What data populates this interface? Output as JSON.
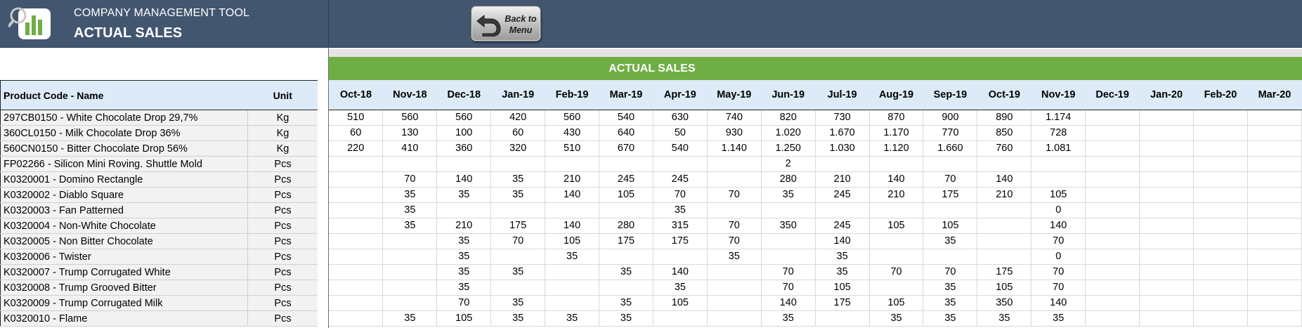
{
  "header": {
    "app_name": "COMPANY MANAGEMENT TOOL",
    "page_title": "ACTUAL SALES",
    "logo_icon": "chart-magnifier-icon",
    "colors": {
      "header_bg": "#435670",
      "band_green": "#6fae44",
      "header_row_blue": "#dcebf7"
    }
  },
  "back_button": {
    "label": "Back to\nMenu",
    "icon": "back-arrow-icon"
  },
  "band": {
    "title": "ACTUAL SALES"
  },
  "columns": {
    "product": "Product Code - Name",
    "unit": "Unit"
  },
  "months": [
    "Oct-18",
    "Nov-18",
    "Dec-18",
    "Jan-19",
    "Feb-19",
    "Mar-19",
    "Apr-19",
    "May-19",
    "Jun-19",
    "Jul-19",
    "Aug-19",
    "Sep-19",
    "Oct-19",
    "Nov-19",
    "Dec-19",
    "Jan-20",
    "Feb-20",
    "Mar-20"
  ],
  "rows": [
    {
      "product": "297CB0150 - White Chocolate Drop 29,7%",
      "unit": "Kg",
      "values": [
        "510",
        "560",
        "560",
        "420",
        "560",
        "540",
        "630",
        "740",
        "820",
        "730",
        "870",
        "900",
        "890",
        "1.174",
        "",
        "",
        "",
        ""
      ]
    },
    {
      "product": "360CL0150 - Milk Chocolate Drop 36%",
      "unit": "Kg",
      "values": [
        "60",
        "130",
        "100",
        "60",
        "430",
        "640",
        "50",
        "930",
        "1.020",
        "1.670",
        "1.170",
        "770",
        "850",
        "728",
        "",
        "",
        "",
        ""
      ]
    },
    {
      "product": "560CN0150 - Bitter Chocolate Drop 56%",
      "unit": "Kg",
      "values": [
        "220",
        "410",
        "360",
        "320",
        "510",
        "670",
        "540",
        "1.140",
        "1.250",
        "1.030",
        "1.120",
        "1.660",
        "760",
        "1.081",
        "",
        "",
        "",
        ""
      ]
    },
    {
      "product": "FP02266 - Silicon Mini Roving. Shuttle Mold",
      "unit": "Pcs",
      "values": [
        "",
        "",
        "",
        "",
        "",
        "",
        "",
        "",
        "2",
        "",
        "",
        "",
        "",
        "",
        "",
        "",
        "",
        ""
      ]
    },
    {
      "product": "K0320001 - Domino Rectangle",
      "unit": "Pcs",
      "values": [
        "",
        "70",
        "140",
        "35",
        "210",
        "245",
        "245",
        "",
        "280",
        "210",
        "140",
        "70",
        "140",
        "",
        "",
        "",
        "",
        ""
      ]
    },
    {
      "product": "K0320002 - Diablo Square",
      "unit": "Pcs",
      "values": [
        "",
        "35",
        "35",
        "35",
        "140",
        "105",
        "70",
        "70",
        "35",
        "245",
        "210",
        "175",
        "210",
        "105",
        "",
        "",
        "",
        ""
      ]
    },
    {
      "product": "K0320003 - Fan Patterned",
      "unit": "Pcs",
      "values": [
        "",
        "35",
        "",
        "",
        "",
        "",
        "35",
        "",
        "",
        "",
        "",
        "",
        "",
        "0",
        "",
        "",
        "",
        ""
      ]
    },
    {
      "product": "K0320004 - Non-White Chocolate",
      "unit": "Pcs",
      "values": [
        "",
        "35",
        "210",
        "175",
        "140",
        "280",
        "315",
        "70",
        "350",
        "245",
        "105",
        "105",
        "",
        "140",
        "",
        "",
        "",
        ""
      ]
    },
    {
      "product": "K0320005 - Non Bitter Chocolate",
      "unit": "Pcs",
      "values": [
        "",
        "",
        "35",
        "70",
        "105",
        "175",
        "175",
        "70",
        "",
        "140",
        "",
        "35",
        "",
        "70",
        "",
        "",
        "",
        ""
      ]
    },
    {
      "product": "K0320006 - Twister",
      "unit": "Pcs",
      "values": [
        "",
        "",
        "35",
        "",
        "35",
        "",
        "",
        "35",
        "",
        "35",
        "",
        "",
        "",
        "0",
        "",
        "",
        "",
        ""
      ]
    },
    {
      "product": "K0320007 - Trump Corrugated White",
      "unit": "Pcs",
      "values": [
        "",
        "",
        "35",
        "35",
        "",
        "35",
        "140",
        "",
        "70",
        "35",
        "70",
        "70",
        "175",
        "70",
        "",
        "",
        "",
        ""
      ]
    },
    {
      "product": "K0320008 - Trump Grooved Bitter",
      "unit": "Pcs",
      "values": [
        "",
        "",
        "35",
        "",
        "",
        "",
        "35",
        "",
        "70",
        "105",
        "",
        "35",
        "105",
        "70",
        "",
        "",
        "",
        ""
      ]
    },
    {
      "product": "K0320009 - Trump Corrugated Milk",
      "unit": "Pcs",
      "values": [
        "",
        "",
        "70",
        "35",
        "",
        "35",
        "105",
        "",
        "140",
        "175",
        "105",
        "35",
        "350",
        "140",
        "",
        "",
        "",
        ""
      ]
    },
    {
      "product": "K0320010 - Flame",
      "unit": "Pcs",
      "values": [
        "",
        "35",
        "105",
        "35",
        "35",
        "35",
        "",
        "",
        "35",
        "",
        "35",
        "35",
        "35",
        "35",
        "",
        "",
        "",
        ""
      ]
    }
  ]
}
